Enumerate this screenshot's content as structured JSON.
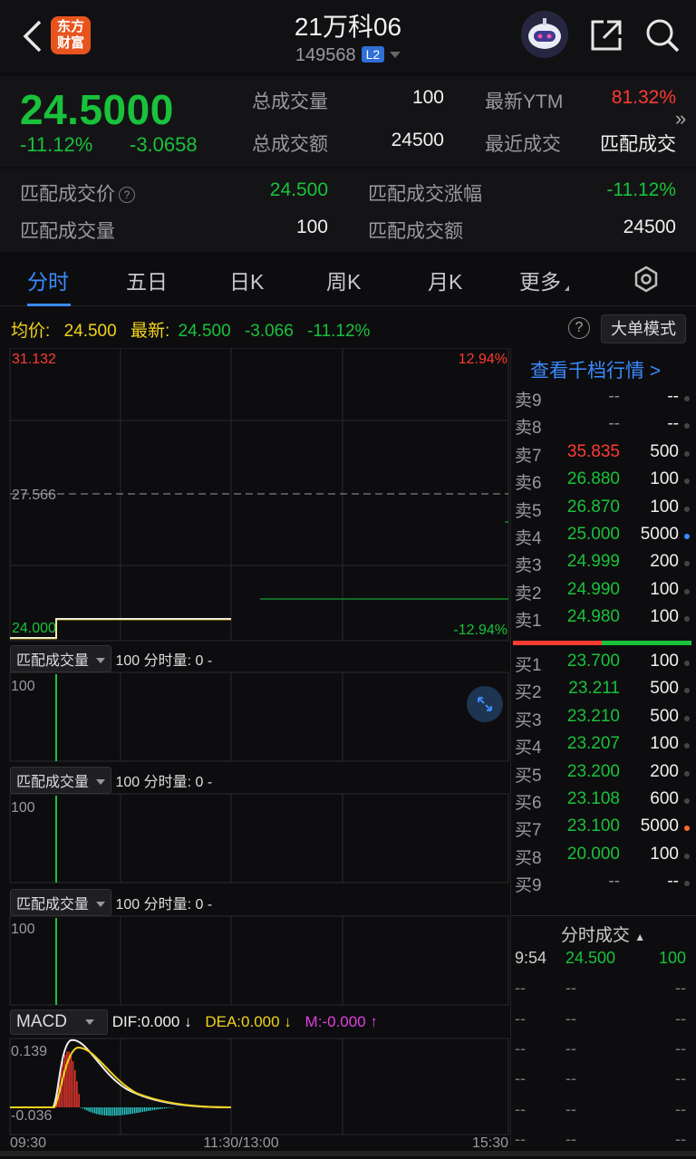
{
  "header": {
    "title": "21万科06",
    "code": "149568",
    "level_badge": "L2",
    "logo_text_1": "东方",
    "logo_text_2": "财富"
  },
  "quote": {
    "price": "24.5000",
    "pct": "-11.12%",
    "change": "-3.0658",
    "total_volume_label": "总成交量",
    "total_volume": "100",
    "total_amount_label": "总成交额",
    "total_amount": "24500",
    "ytm_label": "最新YTM",
    "ytm": "81.32%",
    "recent_label": "最近成交",
    "recent": "匹配成交"
  },
  "match": {
    "price_label": "匹配成交价",
    "price": "24.500",
    "change_pct_label": "匹配成交涨幅",
    "change_pct": "-11.12%",
    "volume_label": "匹配成交量",
    "volume": "100",
    "amount_label": "匹配成交额",
    "amount": "24500"
  },
  "tabs": [
    "分时",
    "五日",
    "日K",
    "周K",
    "月K",
    "更多"
  ],
  "info": {
    "avg_label": "均价:",
    "avg": "24.500",
    "latest_label": "最新:",
    "latest": "24.500",
    "change": "-3.066",
    "pct": "-11.12%",
    "help": "?",
    "big_order": "大单模式"
  },
  "chart": {
    "y_top": "31.132",
    "y_mid": "27.566",
    "y_bottom": "24.000",
    "pct_top": "12.94%",
    "pct_bottom": "-12.94%",
    "sub_panels": [
      {
        "selector": "匹配成交量",
        "text": "100 分时量: 0 -",
        "axis": "100"
      },
      {
        "selector": "匹配成交量",
        "text": "100 分时量: 0 -",
        "axis": "100"
      },
      {
        "selector": "匹配成交量",
        "text": "100 分时量: 0 -",
        "axis": "100"
      }
    ],
    "macd": {
      "selector": "MACD",
      "dif": "DIF:0.000 ↓",
      "dea": "DEA:0.000 ↓",
      "m": "M:-0.000 ↑",
      "y_top": "0.139",
      "y_bottom": "-0.036"
    },
    "time_labels": [
      "09:30",
      "11:30/13:00",
      "15:30"
    ]
  },
  "order_book": {
    "link": "查看千档行情 >",
    "asks": [
      {
        "label": "卖9",
        "price": "--",
        "vol": "--",
        "price_color": "gray"
      },
      {
        "label": "卖8",
        "price": "--",
        "vol": "--",
        "price_color": "gray"
      },
      {
        "label": "卖7",
        "price": "35.835",
        "vol": "500",
        "price_color": "red"
      },
      {
        "label": "卖6",
        "price": "26.880",
        "vol": "100",
        "price_color": "green"
      },
      {
        "label": "卖5",
        "price": "26.870",
        "vol": "100",
        "price_color": "green"
      },
      {
        "label": "卖4",
        "price": "25.000",
        "vol": "5000",
        "price_color": "green"
      },
      {
        "label": "卖3",
        "price": "24.999",
        "vol": "200",
        "price_color": "green"
      },
      {
        "label": "卖2",
        "price": "24.990",
        "vol": "100",
        "price_color": "green"
      },
      {
        "label": "卖1",
        "price": "24.980",
        "vol": "100",
        "price_color": "green"
      }
    ],
    "bids": [
      {
        "label": "买1",
        "price": "23.700",
        "vol": "100",
        "price_color": "green"
      },
      {
        "label": "买2",
        "price": "23.211",
        "vol": "500",
        "price_color": "green"
      },
      {
        "label": "买3",
        "price": "23.210",
        "vol": "500",
        "price_color": "green"
      },
      {
        "label": "买4",
        "price": "23.207",
        "vol": "100",
        "price_color": "green"
      },
      {
        "label": "买5",
        "price": "23.200",
        "vol": "200",
        "price_color": "green"
      },
      {
        "label": "买6",
        "price": "23.108",
        "vol": "600",
        "price_color": "green"
      },
      {
        "label": "买7",
        "price": "23.100",
        "vol": "5000",
        "price_color": "green"
      },
      {
        "label": "买8",
        "price": "20.000",
        "vol": "100",
        "price_color": "green"
      },
      {
        "label": "买9",
        "price": "--",
        "vol": "--",
        "price_color": "gray"
      }
    ],
    "ticks_header": "分时成交",
    "ticks": [
      {
        "time": "9:54",
        "price": "24.500",
        "vol": "100"
      },
      {
        "time": "--",
        "price": "--",
        "vol": "--"
      },
      {
        "time": "--",
        "price": "--",
        "vol": "--"
      },
      {
        "time": "--",
        "price": "--",
        "vol": "--"
      },
      {
        "time": "--",
        "price": "--",
        "vol": "--"
      },
      {
        "time": "--",
        "price": "--",
        "vol": "--"
      },
      {
        "time": "--",
        "price": "--",
        "vol": "--"
      }
    ]
  },
  "colors": {
    "up": "#ff3b30",
    "down": "#19c23a",
    "accent": "#3a8bff",
    "avg_line": "#f2d21c"
  }
}
